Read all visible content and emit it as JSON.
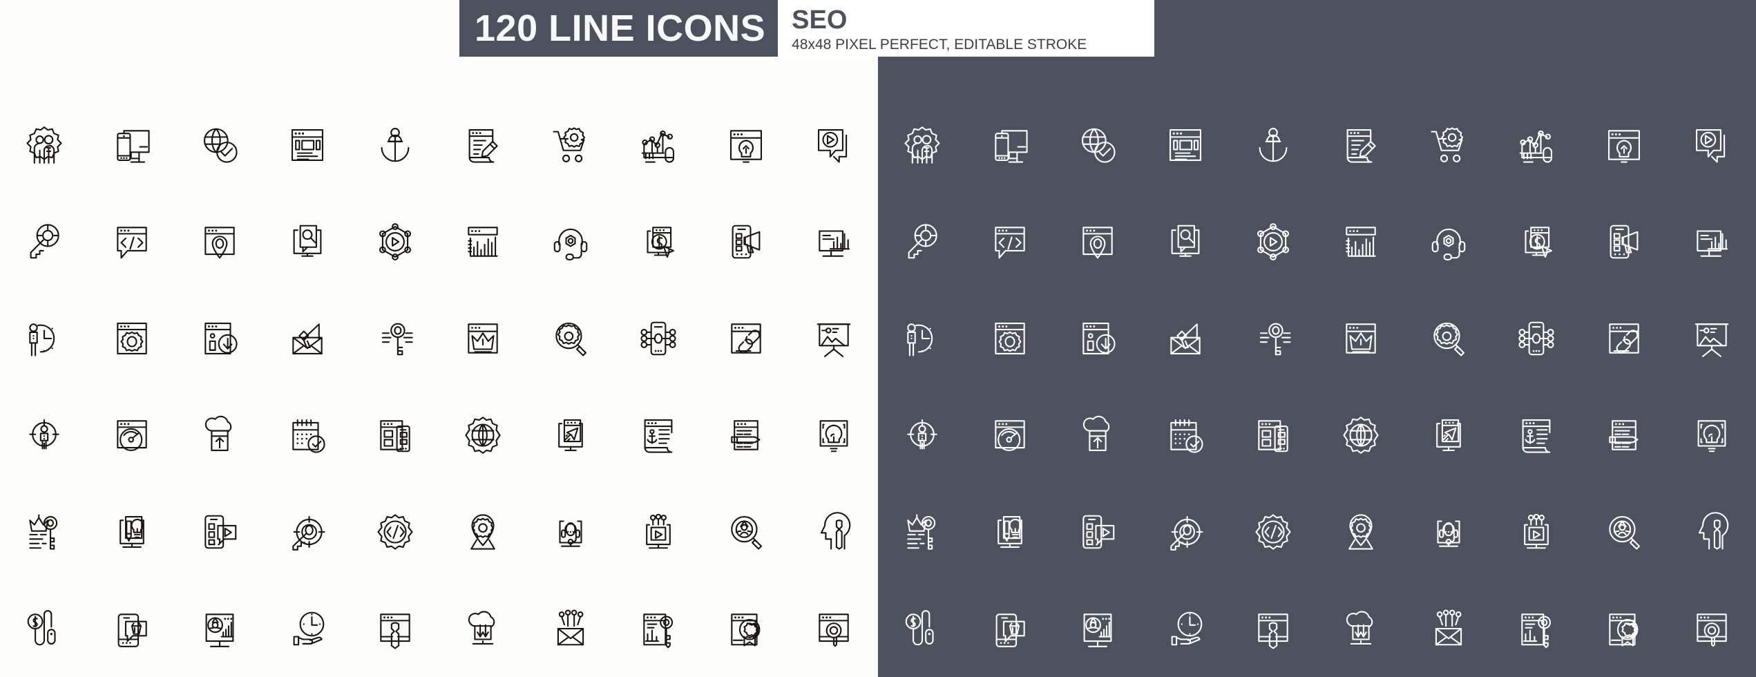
{
  "banner": {
    "title": "120 LINE ICONS",
    "subtitle": "SEO",
    "description": "48x48 PIXEL PERFECT, EDITABLE STROKE",
    "dark_color": "#4b525d",
    "light_color": "#ffffff",
    "title_text_color": "#f7f8f9"
  },
  "layout": {
    "columns": 10,
    "rows": 6,
    "total_icons": 120,
    "unique_icons": 60,
    "light_panel_background": "#fdfdfc",
    "dark_panel_background": "#4b525d",
    "light_stroke_color": "#19150f",
    "dark_stroke_color": "#ffffff"
  },
  "icons": [
    {
      "id": "users-gear-icon",
      "label": "Team Management"
    },
    {
      "id": "responsive-devices-icon",
      "label": "Responsive Devices"
    },
    {
      "id": "globe-check-icon",
      "label": "Verified Website"
    },
    {
      "id": "webpage-layout-icon",
      "label": "Web Page Layout"
    },
    {
      "id": "anchor-icon",
      "label": "Anchor Link"
    },
    {
      "id": "copywriting-icon",
      "label": "Copywriting"
    },
    {
      "id": "cart-gear-icon",
      "label": "E-commerce Settings"
    },
    {
      "id": "analytics-graph-icon",
      "label": "Growth Analytics"
    },
    {
      "id": "lightbulb-browser-icon",
      "label": "Web Idea"
    },
    {
      "id": "video-chat-icon",
      "label": "Video Messaging"
    },
    {
      "id": "keyword-target-icon",
      "label": "Keyword Targeting"
    },
    {
      "id": "code-chat-icon",
      "label": "Code Comment"
    },
    {
      "id": "local-seo-pin-icon",
      "label": "Local SEO"
    },
    {
      "id": "content-search-monitor-icon",
      "label": "Content Search"
    },
    {
      "id": "video-network-icon",
      "label": "Video Network"
    },
    {
      "id": "bar-chart-browser-icon",
      "label": "Traffic Report"
    },
    {
      "id": "headset-support-icon",
      "label": "Customer Support"
    },
    {
      "id": "ppc-click-icon",
      "label": "Pay Per Click"
    },
    {
      "id": "mobile-megaphone-icon",
      "label": "Mobile Advertising"
    },
    {
      "id": "monitor-analytics-icon",
      "label": "Desktop Analytics"
    },
    {
      "id": "person-clock-icon",
      "label": "Time Management"
    },
    {
      "id": "browser-gear-icon",
      "label": "Site Settings"
    },
    {
      "id": "info-download-icon",
      "label": "Information Download"
    },
    {
      "id": "email-marketing-icon",
      "label": "Email Marketing"
    },
    {
      "id": "keyword-research-icon",
      "label": "Keyword Research"
    },
    {
      "id": "crown-browser-icon",
      "label": "Top Ranking"
    },
    {
      "id": "search-settings-icon",
      "label": "Search Settings"
    },
    {
      "id": "mobile-network-icon",
      "label": "Mobile Network"
    },
    {
      "id": "backlink-browser-icon",
      "label": "Backlinks"
    },
    {
      "id": "image-presentation-icon",
      "label": "Image Presentation"
    },
    {
      "id": "target-audience-icon",
      "label": "Target Audience"
    },
    {
      "id": "speed-gauge-browser-icon",
      "label": "Page Speed"
    },
    {
      "id": "cloud-upload-icon",
      "label": "Cloud Upload"
    },
    {
      "id": "calendar-check-icon",
      "label": "Content Calendar"
    },
    {
      "id": "responsive-layout-icon",
      "label": "Adaptive Layout"
    },
    {
      "id": "globe-gear-icon",
      "label": "Global Settings"
    },
    {
      "id": "send-monitor-icon",
      "label": "Campaign Launch"
    },
    {
      "id": "anchor-text-icon",
      "label": "Anchor Text"
    },
    {
      "id": "content-pencil-icon",
      "label": "Content Editing"
    },
    {
      "id": "idea-browser-icon",
      "label": "Creative Website"
    },
    {
      "id": "crown-key-ranking-icon",
      "label": "Ranking Keyword"
    },
    {
      "id": "creative-monitor-icon",
      "label": "Creative Design"
    },
    {
      "id": "mobile-video-icon",
      "label": "Mobile Video"
    },
    {
      "id": "key-target-icon",
      "label": "Keyword Goal"
    },
    {
      "id": "code-gear-icon",
      "label": "Code Optimization"
    },
    {
      "id": "location-gear-icon",
      "label": "Location Settings"
    },
    {
      "id": "support-monitor-icon",
      "label": "Online Support"
    },
    {
      "id": "video-marketing-icon",
      "label": "Video Marketing"
    },
    {
      "id": "audience-search-icon",
      "label": "Audience Insight"
    },
    {
      "id": "seo-mind-icon",
      "label": "SEO Strategy"
    },
    {
      "id": "cost-per-click-icon",
      "label": "Cost Per Click"
    },
    {
      "id": "mobile-shopping-icon",
      "label": "Mobile Shopping"
    },
    {
      "id": "analytics-dashboard-icon",
      "label": "Analytics Dashboard"
    },
    {
      "id": "time-money-icon",
      "label": "Time Is Money"
    },
    {
      "id": "seo-tools-icon",
      "label": "SEO Tools"
    },
    {
      "id": "cloud-download-icon",
      "label": "Cloud Download"
    },
    {
      "id": "email-network-icon",
      "label": "Email Network"
    },
    {
      "id": "keyword-report-icon",
      "label": "Keyword Report"
    },
    {
      "id": "certificate-badge-icon",
      "label": "Quality Certificate"
    },
    {
      "id": "search-browser-icon",
      "label": "Site Search"
    }
  ]
}
